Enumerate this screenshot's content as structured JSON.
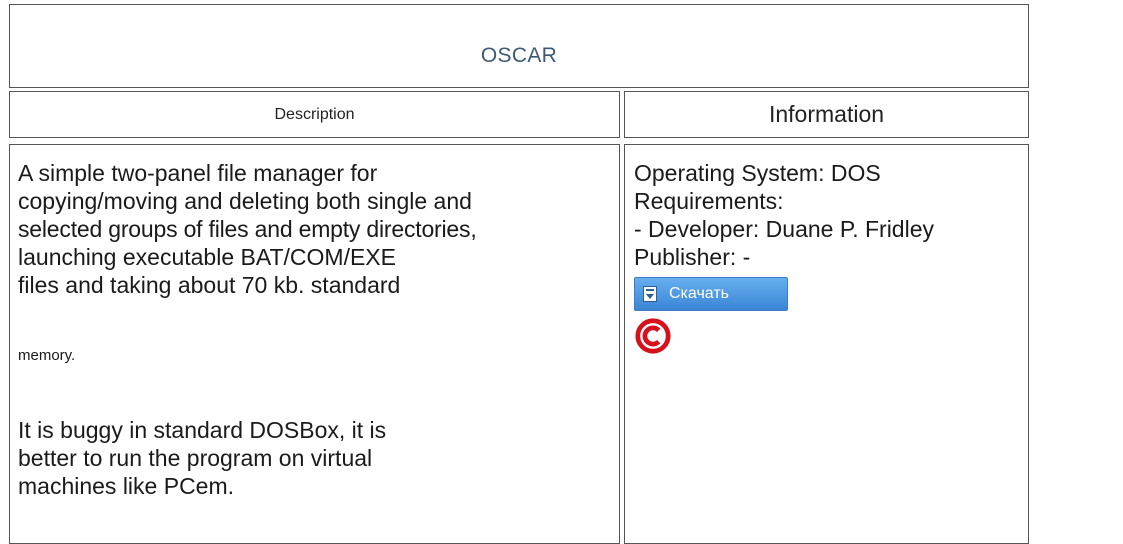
{
  "title": "OSCAR",
  "headers": {
    "description": "Description",
    "information": "Information"
  },
  "description": {
    "lines_large": [
      "A simple two-panel file manager for",
      "copying/moving and deleting both single and",
      "selected groups of files and empty directories,",
      "launching executable BAT/COM/EXE",
      "files and taking about 70 kb. standard"
    ],
    "line_small": "memory.",
    "note_lines": [
      "It is buggy in standard DOSBox, it is",
      "better to run the program on virtual",
      "machines like PCem."
    ]
  },
  "information": {
    "os": "Operating System: DOS",
    "requirements": "Requirements:",
    "developer": "- Developer: Duane P. Fridley",
    "publisher": "Publisher: -",
    "download_label": "Скачать",
    "download_icon": "download-icon",
    "copyright_icon": "copyright-icon",
    "accent_color": "#3a86d6",
    "copyright_color": "#d8101c"
  }
}
